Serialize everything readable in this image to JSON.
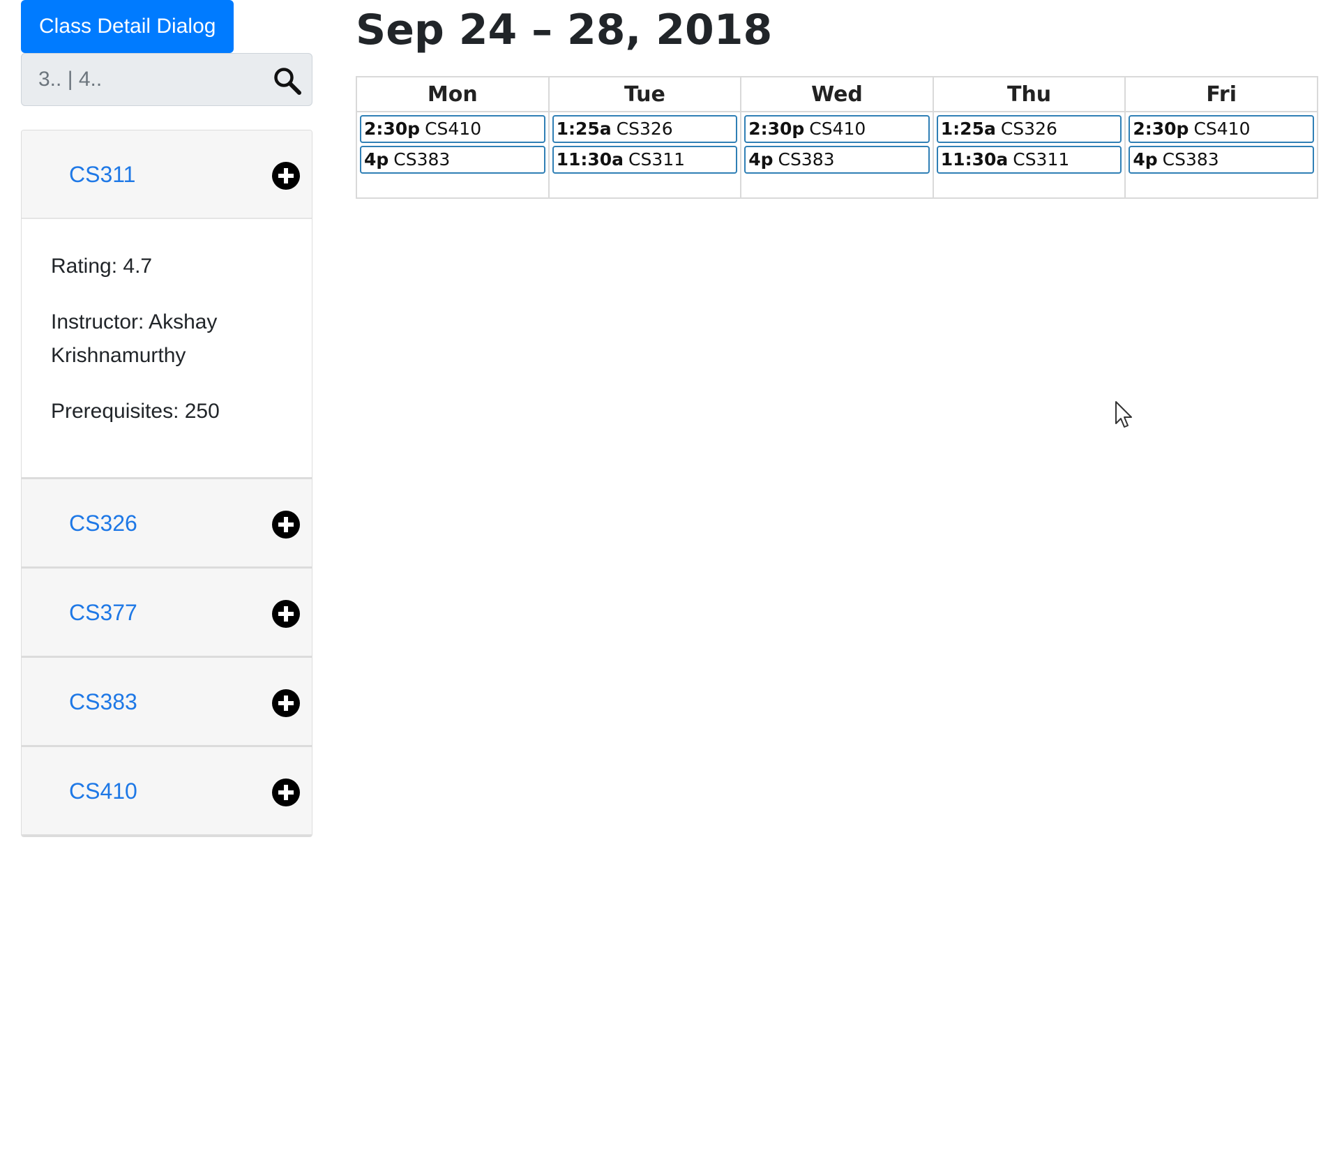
{
  "sidebar": {
    "dialog_button_label": "Class Detail Dialog",
    "search": {
      "value": "",
      "placeholder": "3.. | 4..",
      "icon": "search-icon"
    },
    "courses": [
      {
        "code": "CS311",
        "expanded": true,
        "action_icon": "plus-circle-icon",
        "details": {
          "rating": "Rating: 4.7",
          "instructor": "Instructor: Akshay Krishnamurthy",
          "prerequisites": "Prerequisites: 250"
        }
      },
      {
        "code": "CS326",
        "expanded": false,
        "action_icon": "plus-circle-icon"
      },
      {
        "code": "CS377",
        "expanded": false,
        "action_icon": "plus-circle-icon"
      },
      {
        "code": "CS383",
        "expanded": false,
        "action_icon": "plus-circle-icon"
      },
      {
        "code": "CS410",
        "expanded": false,
        "action_icon": "plus-circle-icon"
      }
    ]
  },
  "calendar": {
    "title": "Sep 24 – 28, 2018",
    "days": [
      {
        "label": "Mon",
        "events": [
          {
            "time": "2:30p",
            "course": "CS410"
          },
          {
            "time": "4p",
            "course": "CS383"
          }
        ]
      },
      {
        "label": "Tue",
        "events": [
          {
            "time": "1:25a",
            "course": "CS326"
          },
          {
            "time": "11:30a",
            "course": "CS311"
          }
        ]
      },
      {
        "label": "Wed",
        "events": [
          {
            "time": "2:30p",
            "course": "CS410"
          },
          {
            "time": "4p",
            "course": "CS383"
          }
        ]
      },
      {
        "label": "Thu",
        "events": [
          {
            "time": "1:25a",
            "course": "CS326"
          },
          {
            "time": "11:30a",
            "course": "CS311"
          }
        ]
      },
      {
        "label": "Fri",
        "events": [
          {
            "time": "2:30p",
            "course": "CS410"
          },
          {
            "time": "4p",
            "course": "CS383"
          }
        ]
      }
    ]
  },
  "colors": {
    "primary": "#007bff",
    "link": "#1e78e6",
    "event_border": "#2f7fb5",
    "panel_header": "#f6f6f6"
  }
}
